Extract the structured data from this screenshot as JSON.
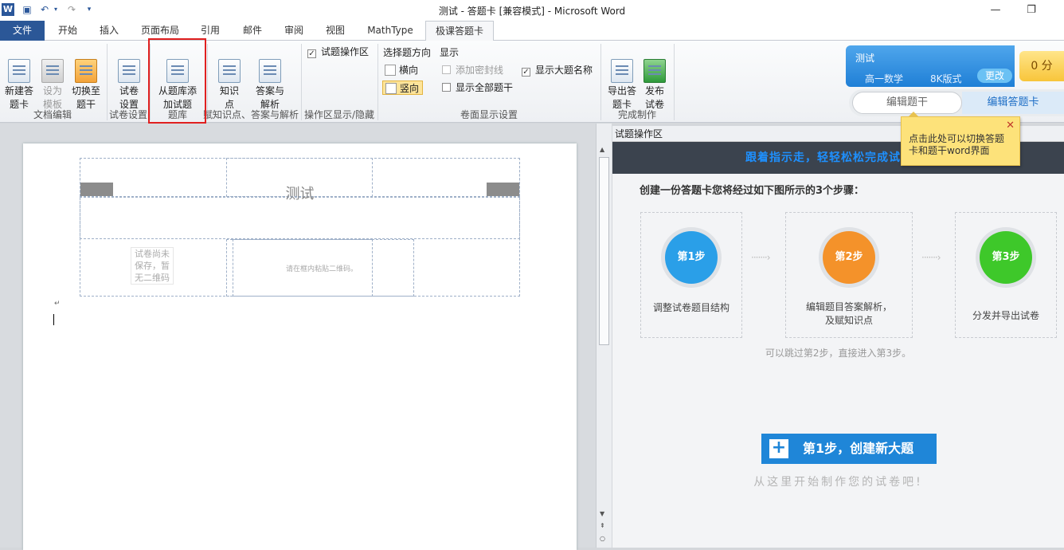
{
  "window": {
    "title": "测试 - 答题卡 [兼容模式] - Microsoft Word",
    "minimize_glyph": "—",
    "restore_glyph": "❐"
  },
  "tabs": [
    "文件",
    "开始",
    "插入",
    "页面布局",
    "引用",
    "邮件",
    "审阅",
    "视图",
    "MathType",
    "极课答题卡"
  ],
  "active_tab": "极课答题卡",
  "ribbon": {
    "new_card": "新建答\n题卡",
    "set_template": "设为\n模板",
    "switch_stem": "切换至\n题干",
    "paper_settings": "试卷\n设置",
    "add_from_bank": "从题库添\n加试题",
    "knowledge": "知识\n点",
    "answer_analysis": "答案与\n解析",
    "op_area": "试题操作区",
    "direction_label": "选择题方向",
    "horizontal": "横向",
    "vertical": "竖向",
    "display_label": "显示",
    "seal_line": "添加密封线",
    "show_all_stems": "显示全部题干",
    "show_big_names": "显示大题名称",
    "export_card": "导出答\n题卡",
    "publish": "发布\n试卷",
    "groups": {
      "doc_edit": "文档编辑",
      "paper_settings": "试卷设置",
      "bank": "题库",
      "knowledge": "赋知识点、答案与解析",
      "op_toggle": "操作区显示/隐藏",
      "layout_settings": "卷面显示设置",
      "finish": "完成制作"
    }
  },
  "header_widget": {
    "test_name": "测试",
    "subject": "高一数学",
    "format": "8K版式",
    "change": "更改",
    "score": "0 分",
    "mode_stem": "编辑题干",
    "mode_card": "编辑答题卡"
  },
  "tooltip": {
    "text": "点击此处可以切换答题卡和题干word界面",
    "close": "✕"
  },
  "document": {
    "title": "测试",
    "save_note": "试卷尚未保存，暂无二维码",
    "qr_note": "请在框内粘贴二维码。"
  },
  "pane": {
    "header": "试题操作区",
    "banner": "跟着指示走，轻轻松松完成试卷",
    "intro": "创建一份答题卡您将经过如下图所示的3个步骤：",
    "steps": [
      {
        "label": "第1步",
        "text": "调整试卷题目结构",
        "color": "#2a9fe8"
      },
      {
        "label": "第2步",
        "text": "编辑题目答案解析，\n及赋知识点",
        "color": "#f4922a"
      },
      {
        "label": "第3步",
        "text": "分发并导出试卷",
        "color": "#3ec82a"
      }
    ],
    "arrow": "·······›",
    "skip_note": "可以跳过第2步，直接进入第3步。",
    "create_plus": "+",
    "create_label": "第1步，创建新大题",
    "start_note": "从这里开始制作您的试卷吧!"
  },
  "colors": {
    "file_tab": "#2b5797",
    "highlight": "#e02020",
    "accent_blue": "#1f86d8"
  }
}
